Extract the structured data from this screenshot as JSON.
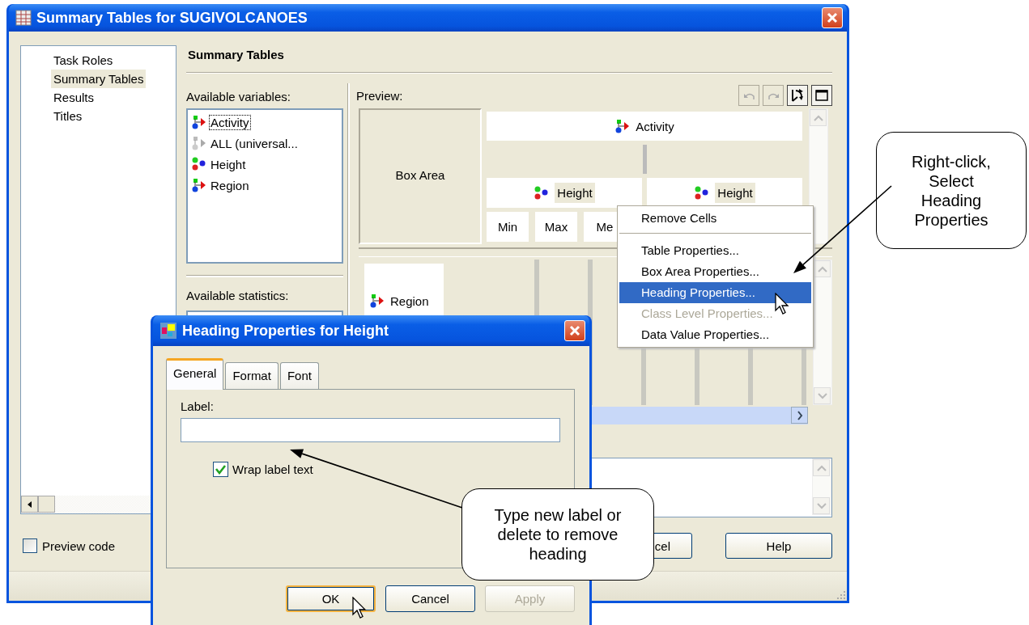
{
  "window": {
    "title": "Summary Tables for SUGIVOLCANOES"
  },
  "nav": [
    {
      "label": "Task Roles",
      "selected": false
    },
    {
      "label": "Summary Tables",
      "selected": true
    },
    {
      "label": "Results",
      "selected": false
    },
    {
      "label": "Titles",
      "selected": false
    }
  ],
  "page_title": "Summary Tables",
  "variables": {
    "label": "Available variables:",
    "items": [
      {
        "label": "Activity",
        "kind": "class",
        "selected": true
      },
      {
        "label": "ALL (universal...",
        "kind": "universal",
        "selected": false
      },
      {
        "label": "Height",
        "kind": "analysis",
        "selected": false
      },
      {
        "label": "Region",
        "kind": "class",
        "selected": false
      }
    ]
  },
  "statistics": {
    "label": "Available statistics:"
  },
  "preview": {
    "label": "Preview:",
    "toolbar": [
      {
        "kind": "undo",
        "disabled": true
      },
      {
        "kind": "redo",
        "disabled": true
      },
      {
        "kind": "pivot",
        "disabled": false
      },
      {
        "kind": "maximize",
        "disabled": false
      }
    ],
    "box_area": "Box Area",
    "column_heading": {
      "label": "Activity",
      "kind": "class"
    },
    "sub_headings": [
      {
        "label": "Height",
        "kind": "analysis"
      },
      {
        "label": "Height",
        "kind": "analysis"
      }
    ],
    "statistics": [
      "Min",
      "Max",
      "Me"
    ],
    "row_heading": {
      "label": "Region",
      "kind": "class"
    }
  },
  "preview_code": {
    "label": "Preview code",
    "checked": false
  },
  "buttons": [
    {
      "label": "cel"
    },
    {
      "label": "Help"
    }
  ],
  "context_menu": [
    {
      "kind": "item",
      "label": "Remove Cells",
      "selected": false,
      "disabled": false
    },
    {
      "kind": "separator"
    },
    {
      "kind": "item",
      "label": "Table Properties...",
      "selected": false,
      "disabled": false
    },
    {
      "kind": "item",
      "label": "Box Area Properties...",
      "selected": false,
      "disabled": false
    },
    {
      "kind": "item",
      "label": "Heading Properties...",
      "selected": true,
      "disabled": false
    },
    {
      "kind": "item",
      "label": "Class Level Properties...",
      "selected": false,
      "disabled": true
    },
    {
      "kind": "item",
      "label": "Data Value Properties...",
      "selected": false,
      "disabled": false
    }
  ],
  "dialog": {
    "title": "Heading Properties for Height",
    "tabs": [
      {
        "label": "General",
        "selected": true
      },
      {
        "label": "Format",
        "selected": false
      },
      {
        "label": "Font",
        "selected": false
      }
    ],
    "label_field": {
      "label": "Label:"
    },
    "wrap": {
      "label": "Wrap label text",
      "checked": true
    },
    "buttons": [
      {
        "label": "OK",
        "default": true,
        "disabled": false
      },
      {
        "label": "Cancel",
        "default": false,
        "disabled": false
      },
      {
        "label": "Apply",
        "default": false,
        "disabled": true
      }
    ]
  },
  "callouts": [
    {
      "text": "Right-click,\nSelect\nHeading\nProperties"
    },
    {
      "text": "Type new label or\ndelete to remove\nheading"
    }
  ]
}
